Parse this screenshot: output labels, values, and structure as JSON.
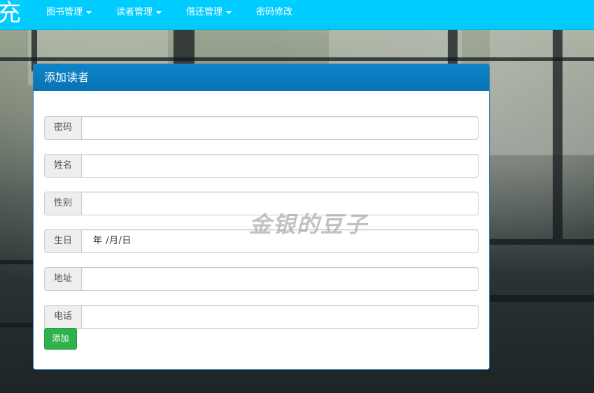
{
  "navbar": {
    "brand": "充",
    "items": [
      {
        "label": "图书管理",
        "dropdown": true
      },
      {
        "label": "读者管理",
        "dropdown": true
      },
      {
        "label": "借还管理",
        "dropdown": true
      },
      {
        "label": "密码修改",
        "dropdown": false
      }
    ],
    "color": "#01ccff"
  },
  "panel": {
    "title": "添加读者",
    "header_color": "#0a7bbd",
    "fields": [
      {
        "label": "密码",
        "value": ""
      },
      {
        "label": "姓名",
        "value": ""
      },
      {
        "label": "性别",
        "value": ""
      },
      {
        "label": "生日",
        "value": "年 /月/日"
      },
      {
        "label": "地址",
        "value": ""
      },
      {
        "label": "电话",
        "value": ""
      }
    ],
    "submit_label": "添加",
    "submit_color": "#2fb24c"
  },
  "watermark": "金银的豆子"
}
